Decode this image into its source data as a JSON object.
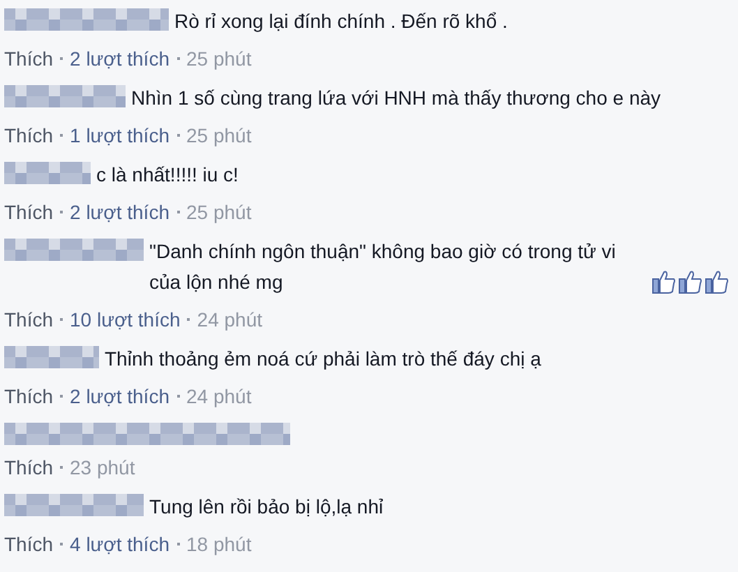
{
  "comments": [
    {
      "text": "Rò rỉ xong lại đính chính . Đến rõ khổ .",
      "like_action": "Thích",
      "likes": "2 lượt thích",
      "time": "25 phút"
    },
    {
      "text": "Nhìn 1 số cùng trang lứa với HNH mà thấy thương cho e này",
      "like_action": "Thích",
      "likes": "1 lượt thích",
      "time": "25 phút"
    },
    {
      "text": "c là nhất!!!!! iu c!",
      "like_action": "Thích",
      "likes": "2 lượt thích",
      "time": "25 phút"
    },
    {
      "text": "\"Danh chính ngôn thuận\" không bao giờ có trong tử vi của lộn nhé mg",
      "emoticons": [
        {
          "kind": "thumbs-up"
        },
        {
          "kind": "thumbs-up"
        },
        {
          "kind": "thumbs-up"
        }
      ],
      "like_action": "Thích",
      "likes": "10 lượt thích",
      "time": "24 phút"
    },
    {
      "text": "Thỉnh thoảng ẻm noá cứ phải làm trò thế đáy chị ạ",
      "like_action": "Thích",
      "likes": "2 lượt thích",
      "time": "24 phút"
    },
    {
      "like_action": "Thích",
      "time": "23 phút"
    },
    {
      "text": "Tung lên rồi bảo bị lộ,lạ nhỉ",
      "like_action": "Thích",
      "likes": "4 lượt thích",
      "time": "18 phút"
    }
  ]
}
